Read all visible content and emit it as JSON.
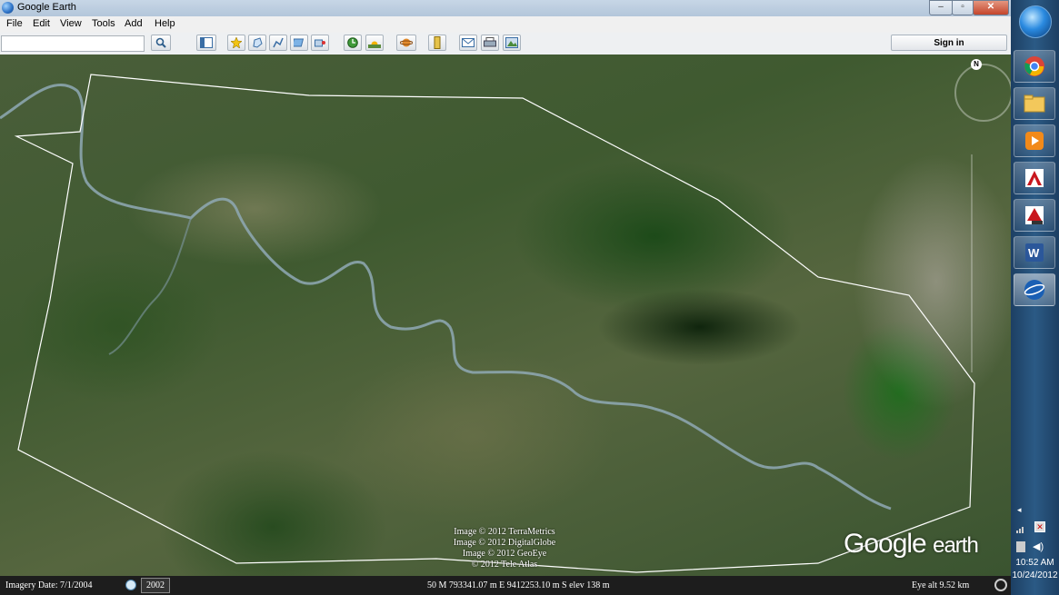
{
  "window": {
    "title": "Google Earth",
    "controls": [
      "–",
      "▫",
      "✕"
    ]
  },
  "menu": [
    "File",
    "Edit",
    "View",
    "Tools",
    "Add",
    "Help"
  ],
  "toolbar": {
    "search_value": "",
    "sign_in": "Sign in",
    "buttons": [
      "search-icon",
      "sidebar-toggle-icon",
      "placemark-icon",
      "polygon-icon",
      "path-icon",
      "image-overlay-icon",
      "record-tour-icon",
      "historical-imagery-icon",
      "sunlight-icon",
      "planets-icon",
      "ruler-icon",
      "email-icon",
      "print-icon",
      "save-image-icon"
    ]
  },
  "map": {
    "compass_label": "N",
    "copyright": [
      "Image © 2012 TerraMetrics",
      "Image © 2012 DigitalGlobe",
      "Image © 2012 GeoEye",
      "© 2012 Tele Atlas"
    ],
    "logo": {
      "main": "Google",
      "sub": "earth"
    }
  },
  "status": {
    "imagery_date": "Imagery Date: 7/1/2004",
    "year": "2002",
    "coordinates": "50 M 793341.07 m E 9412253.10 m S elev  138 m",
    "eye_alt": "Eye alt    9.52 km"
  },
  "taskbar": {
    "apps": [
      "chrome-icon",
      "folder-icon",
      "media-player-icon",
      "autocad-icon",
      "autocad-ldc-icon",
      "word-icon",
      "google-earth-icon"
    ],
    "time": "10:52 AM",
    "date": "10/24/2012"
  },
  "colors": {
    "boundary_line": "#ffffff",
    "river": "#8fa9b5",
    "taskbar": "#2b5a85"
  }
}
